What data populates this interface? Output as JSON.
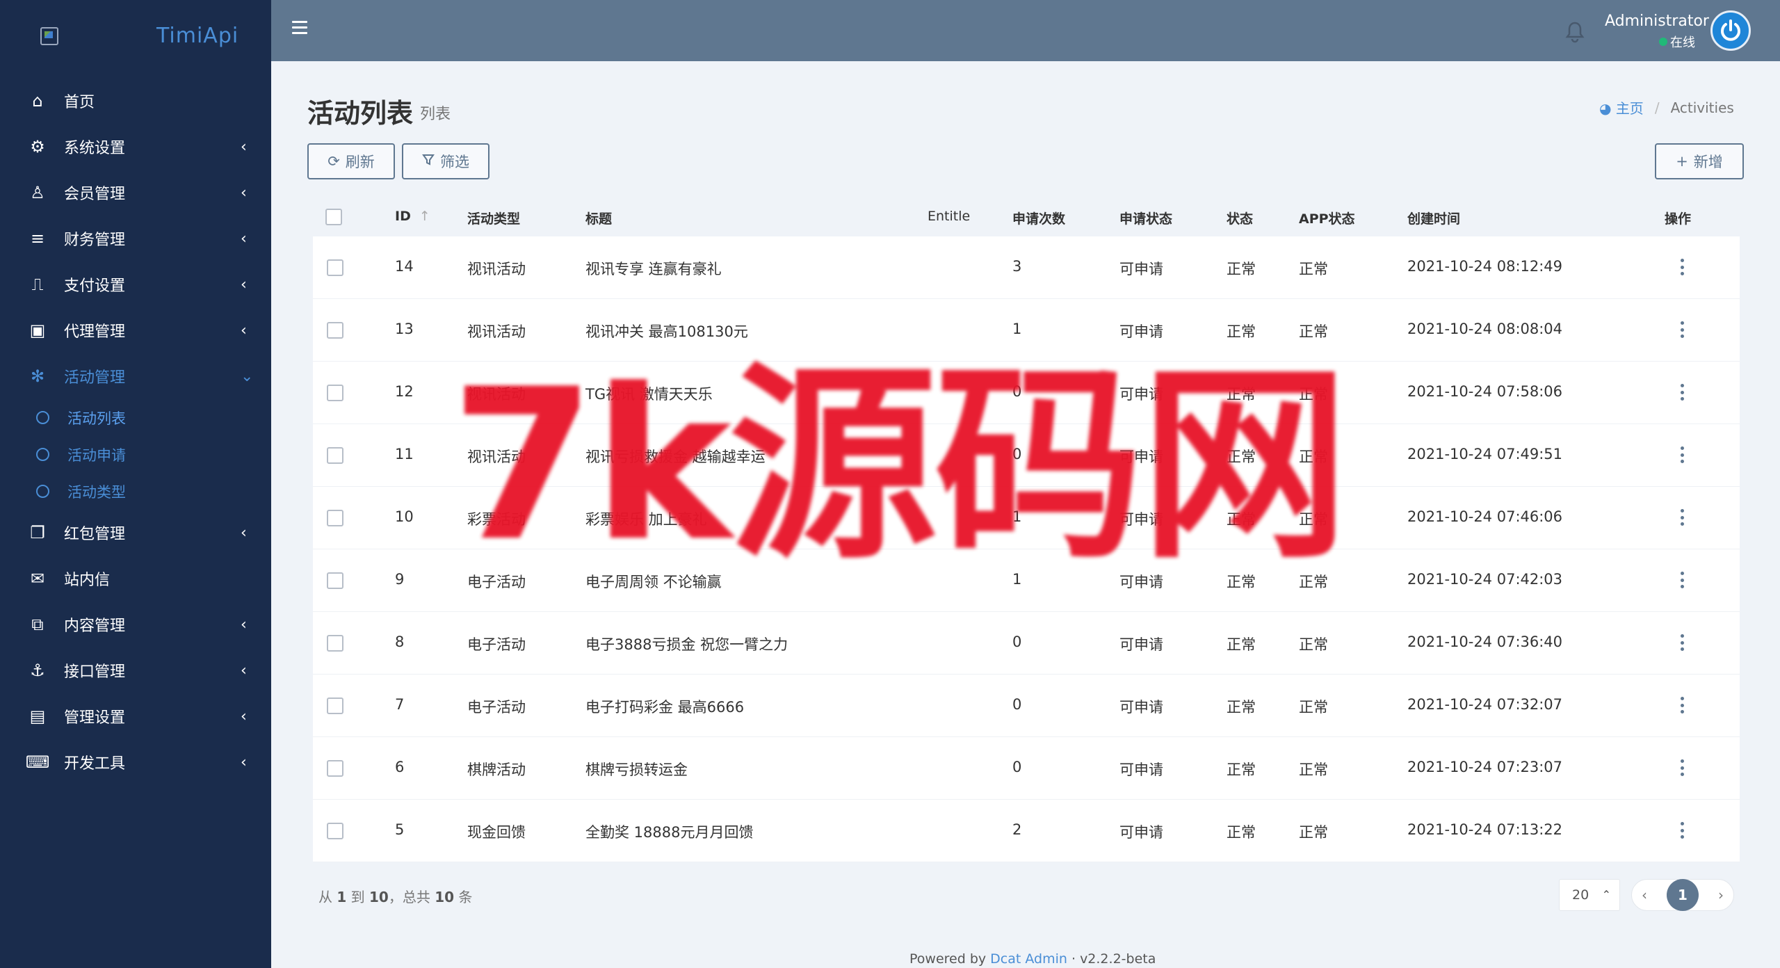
{
  "brand": {
    "name": "TimiApi"
  },
  "sidebar": {
    "items": [
      {
        "label": "首页",
        "icon": "home-icon",
        "glyph": "⌂",
        "arrow": ""
      },
      {
        "label": "系统设置",
        "icon": "cogs-icon",
        "glyph": "⚙",
        "arrow": "‹"
      },
      {
        "label": "会员管理",
        "icon": "user-icon",
        "glyph": "♙",
        "arrow": "‹"
      },
      {
        "label": "财务管理",
        "icon": "database-icon",
        "glyph": "≡",
        "arrow": "‹"
      },
      {
        "label": "支付设置",
        "icon": "bookmark-icon",
        "glyph": "⎍",
        "arrow": "‹"
      },
      {
        "label": "代理管理",
        "icon": "id-badge-icon",
        "glyph": "▣",
        "arrow": "‹"
      },
      {
        "label": "活动管理",
        "icon": "yelp-icon",
        "glyph": "✻",
        "arrow": "⌄"
      }
    ],
    "submenu": [
      {
        "label": "活动列表"
      },
      {
        "label": "活动申请"
      },
      {
        "label": "活动类型"
      }
    ],
    "items_after": [
      {
        "label": "红包管理",
        "icon": "clone-icon",
        "glyph": "❐",
        "arrow": "‹"
      },
      {
        "label": "站内信",
        "icon": "envelope-icon",
        "glyph": "✉",
        "arrow": ""
      },
      {
        "label": "内容管理",
        "icon": "copy-icon",
        "glyph": "⧉",
        "arrow": "‹"
      },
      {
        "label": "接口管理",
        "icon": "anchor-icon",
        "glyph": "⚓",
        "arrow": "‹"
      },
      {
        "label": "管理设置",
        "icon": "address-card-icon",
        "glyph": "▤",
        "arrow": "‹"
      },
      {
        "label": "开发工具",
        "icon": "keyboard-icon",
        "glyph": "⌨",
        "arrow": "‹"
      }
    ]
  },
  "topbar": {
    "user_name": "Administrator",
    "user_status": "在线"
  },
  "page": {
    "title": "活动列表",
    "subtitle": "列表",
    "breadcrumb_home": "主页",
    "breadcrumb_current": "Activities"
  },
  "toolbar": {
    "refresh_label": "刷新",
    "filter_label": "筛选",
    "new_label": "新增"
  },
  "table": {
    "headers": {
      "id": "ID",
      "type": "活动类型",
      "title": "标题",
      "entitle": "Entitle",
      "count": "申请次数",
      "apply_status": "申请状态",
      "status": "状态",
      "app_status": "APP状态",
      "created": "创建时间",
      "op": "操作"
    },
    "rows": [
      {
        "id": "14",
        "type": "视讯活动",
        "title": "视讯专享 连赢有豪礼",
        "entitle": "",
        "count": "3",
        "apply_status": "可申请",
        "status": "正常",
        "app_status": "正常",
        "created": "2021-10-24 08:12:49"
      },
      {
        "id": "13",
        "type": "视讯活动",
        "title": "视讯冲关 最高108130元",
        "entitle": "",
        "count": "1",
        "apply_status": "可申请",
        "status": "正常",
        "app_status": "正常",
        "created": "2021-10-24 08:08:04"
      },
      {
        "id": "12",
        "type": "视讯活动",
        "title": "TG视讯 激情天天乐",
        "entitle": "",
        "count": "0",
        "apply_status": "可申请",
        "status": "正常",
        "app_status": "正常",
        "created": "2021-10-24 07:58:06"
      },
      {
        "id": "11",
        "type": "视讯活动",
        "title": "视讯亏损救援金 越输越幸运",
        "entitle": "",
        "count": "0",
        "apply_status": "可申请",
        "status": "正常",
        "app_status": "正常",
        "created": "2021-10-24 07:49:51"
      },
      {
        "id": "10",
        "type": "彩票活动",
        "title": "彩票娱乐 加上豪礼",
        "entitle": "",
        "count": "1",
        "apply_status": "可申请",
        "status": "正常",
        "app_status": "正常",
        "created": "2021-10-24 07:46:06"
      },
      {
        "id": "9",
        "type": "电子活动",
        "title": "电子周周领 不论输赢",
        "entitle": "",
        "count": "1",
        "apply_status": "可申请",
        "status": "正常",
        "app_status": "正常",
        "created": "2021-10-24 07:42:03"
      },
      {
        "id": "8",
        "type": "电子活动",
        "title": "电子3888亏损金 祝您一臂之力",
        "entitle": "",
        "count": "0",
        "apply_status": "可申请",
        "status": "正常",
        "app_status": "正常",
        "created": "2021-10-24 07:36:40"
      },
      {
        "id": "7",
        "type": "电子活动",
        "title": "电子打码彩金 最高6666",
        "entitle": "",
        "count": "0",
        "apply_status": "可申请",
        "status": "正常",
        "app_status": "正常",
        "created": "2021-10-24 07:32:07"
      },
      {
        "id": "6",
        "type": "棋牌活动",
        "title": "棋牌亏损转运金",
        "entitle": "",
        "count": "0",
        "apply_status": "可申请",
        "status": "正常",
        "app_status": "正常",
        "created": "2021-10-24 07:23:07"
      },
      {
        "id": "5",
        "type": "现金回馈",
        "title": "全勤奖 18888元月月回馈",
        "entitle": "",
        "count": "2",
        "apply_status": "可申请",
        "status": "正常",
        "app_status": "正常",
        "created": "2021-10-24 07:13:22"
      }
    ]
  },
  "pagination": {
    "summary_from": "从",
    "summary_start": "1",
    "summary_to": "到",
    "summary_end": "10",
    "summary_total_prefix": "，总共",
    "summary_total": "10",
    "summary_unit": "条",
    "per_page": "20",
    "current_page": "1"
  },
  "footer": {
    "powered_prefix": "Powered by",
    "powered_link": "Dcat Admin",
    "version": "· v2.2.2-beta"
  },
  "watermark": {
    "text": "7k源码网"
  },
  "colors": {
    "sidebar_bg": "#1a2c4c",
    "topbar_bg": "#5f7790",
    "accent": "#4a8ed6",
    "watermark": "#e8152a"
  }
}
